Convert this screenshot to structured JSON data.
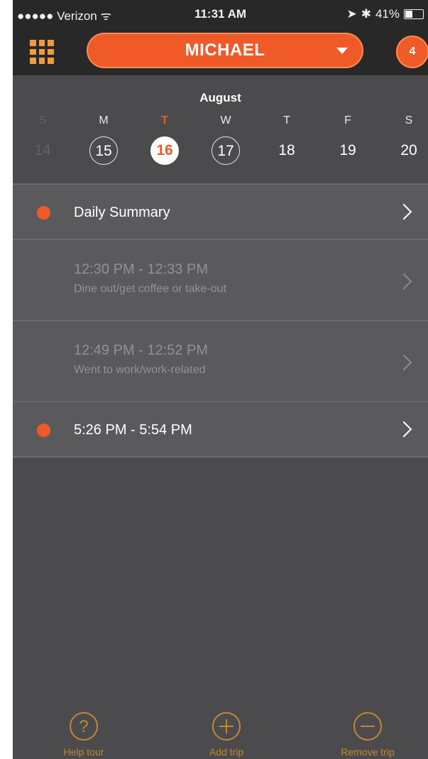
{
  "status_bar": {
    "carrier": "●●●●● Verizon ᯤ",
    "time": "11:31 AM",
    "battery": "41%"
  },
  "header": {
    "user_name": "MICHAEL",
    "badge_count": "4"
  },
  "calendar": {
    "month": "August",
    "days": [
      {
        "dow": "S",
        "num": "14"
      },
      {
        "dow": "M",
        "num": "15"
      },
      {
        "dow": "T",
        "num": "16"
      },
      {
        "dow": "W",
        "num": "17"
      },
      {
        "dow": "T",
        "num": "18"
      },
      {
        "dow": "F",
        "num": "19"
      },
      {
        "dow": "S",
        "num": "20"
      }
    ]
  },
  "trips": [
    {
      "title": "Daily Summary"
    },
    {
      "title": "12:30 PM - 12:33 PM",
      "subtitle": "Dine out/get coffee or take-out"
    },
    {
      "title": "12:49 PM - 12:52 PM",
      "subtitle": "Went to work/work-related"
    },
    {
      "title": "5:26 PM - 5:54 PM"
    }
  ],
  "toolbar": {
    "help_label": "Help tour",
    "add_label": "Add trip",
    "remove_label": "Remove trip",
    "help_symbol": "?"
  },
  "colors": {
    "accent": "#ef5a28",
    "toolbar": "#c4872f",
    "background": "#4b4b4d"
  }
}
